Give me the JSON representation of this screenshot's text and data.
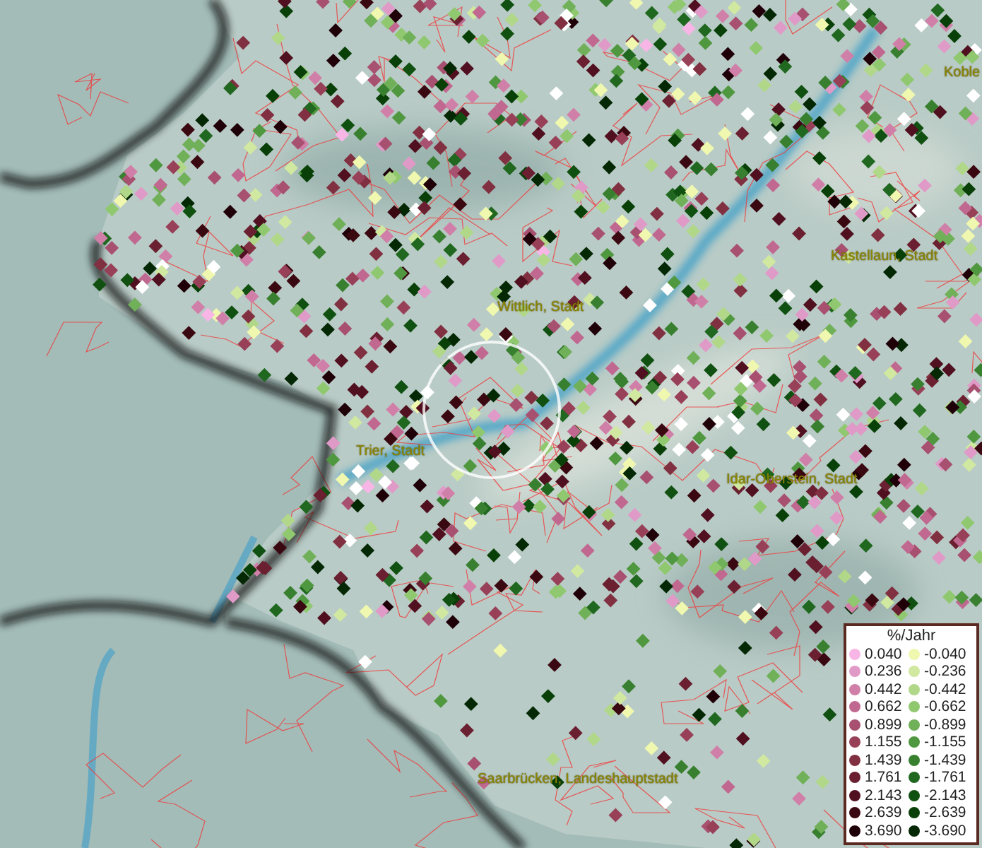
{
  "map": {
    "places": [
      {
        "name": "Koble"
      },
      {
        "name": "Kastellaun, Stadt"
      },
      {
        "name": "Wittlich, Stadt"
      },
      {
        "name": "Trier, Stadt"
      },
      {
        "name": "Idar-Oberstein, Stadt"
      },
      {
        "name": "Saarbrücken, Landeshauptstadt"
      }
    ]
  },
  "legend": {
    "title": "%/Jahr",
    "columns": [
      {
        "items": [
          {
            "value": "0.040",
            "color": "#f7b6e6"
          },
          {
            "value": "0.236",
            "color": "#e09ac8"
          },
          {
            "value": "0.442",
            "color": "#d080a8"
          },
          {
            "value": "0.662",
            "color": "#c06890"
          },
          {
            "value": "0.899",
            "color": "#a85070"
          },
          {
            "value": "1.155",
            "color": "#984058"
          },
          {
            "value": "1.439",
            "color": "#803040"
          },
          {
            "value": "1.761",
            "color": "#6a2030"
          },
          {
            "value": "2.143",
            "color": "#501020"
          },
          {
            "value": "2.639",
            "color": "#3a0810"
          },
          {
            "value": "3.690",
            "color": "#200008"
          }
        ]
      },
      {
        "items": [
          {
            "value": "-0.040",
            "color": "#f0f8b0"
          },
          {
            "value": "-0.236",
            "color": "#d0e8a0"
          },
          {
            "value": "-0.442",
            "color": "#b0d888"
          },
          {
            "value": "-0.662",
            "color": "#90c870"
          },
          {
            "value": "-0.899",
            "color": "#70b058"
          },
          {
            "value": "-1.155",
            "color": "#509840"
          },
          {
            "value": "-1.439",
            "color": "#388030"
          },
          {
            "value": "-1.761",
            "color": "#206820"
          },
          {
            "value": "-2.143",
            "color": "#105010"
          },
          {
            "value": "-2.639",
            "color": "#084008"
          },
          {
            "value": "-3.690",
            "color": "#042804"
          }
        ]
      }
    ]
  }
}
